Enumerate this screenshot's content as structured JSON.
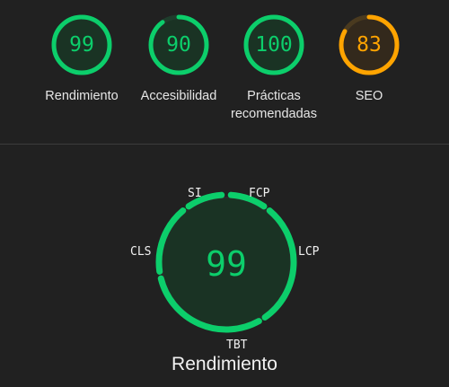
{
  "colors": {
    "pass": "#0cce6b",
    "average": "#ffa400",
    "pass_fill": "#1a3324",
    "average_fill": "#33291c",
    "track_pass": "#1f3d2c",
    "track_average": "#4a3a1f"
  },
  "scores": [
    {
      "label": "Rendimiento",
      "score": "99",
      "value": 99,
      "status": "pass"
    },
    {
      "label": "Accesibilidad",
      "score": "90",
      "value": 90,
      "status": "pass"
    },
    {
      "label": "Prácticas recomendadas",
      "score": "100",
      "value": 100,
      "status": "pass"
    },
    {
      "label": "SEO",
      "score": "83",
      "value": 83,
      "status": "average"
    }
  ],
  "performance": {
    "score": "99",
    "title": "Rendimiento",
    "metrics": [
      {
        "label": "SI"
      },
      {
        "label": "FCP"
      },
      {
        "label": "LCP"
      },
      {
        "label": "TBT"
      },
      {
        "label": "CLS"
      }
    ]
  }
}
